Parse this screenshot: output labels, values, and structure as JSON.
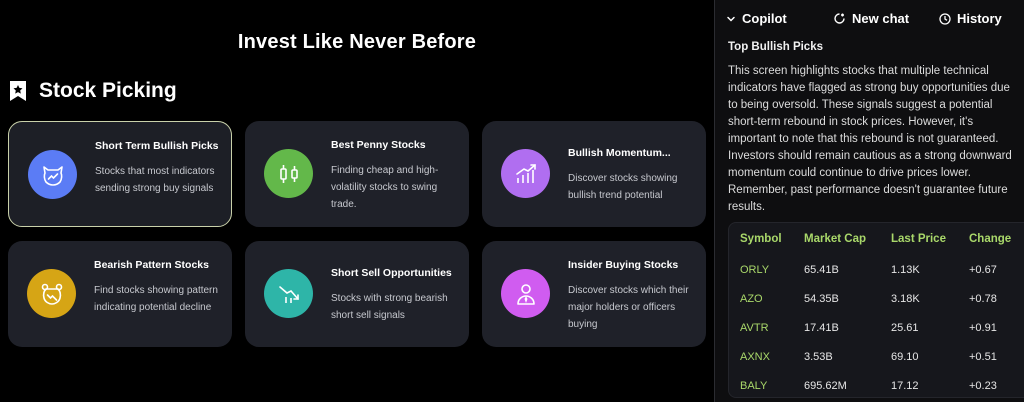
{
  "hero": {
    "title": "Invest Like Never Before"
  },
  "section": {
    "title": "Stock Picking",
    "icon": "bookmark-star-icon"
  },
  "cards": [
    {
      "title": "Short Term Bullish Picks",
      "desc": "Stocks that most indicators sending strong buy signals",
      "icon": "bull-chart-icon",
      "color": "#5b7cf5"
    },
    {
      "title": "Best Penny Stocks",
      "desc": "Finding cheap and high-volatility stocks to swing trade.",
      "icon": "candlestick-icon",
      "color": "#63b84a"
    },
    {
      "title": "Bullish Momentum...",
      "desc": "Discover stocks showing bullish trend potential",
      "icon": "bar-trend-up-icon",
      "color": "#b06ef0"
    },
    {
      "title": "Bearish Pattern Stocks",
      "desc": "Find stocks showing pattern indicating potential decline",
      "icon": "bear-chart-icon",
      "color": "#d6a515"
    },
    {
      "title": "Short Sell Opportunities",
      "desc": "Stocks with strong bearish short sell signals",
      "icon": "trend-down-icon",
      "color": "#2eb5a8"
    },
    {
      "title": "Insider Buying Stocks",
      "desc": "Discover stocks which their major holders or officers buying",
      "icon": "insider-person-icon",
      "color": "#d05cf0"
    }
  ],
  "copilot": {
    "title": "Copilot",
    "new_chat": "New chat",
    "history": "History",
    "answer_title": "Top Bullish Picks",
    "answer_body": "This screen highlights stocks that multiple technical indicators have flagged as strong buy opportunities due to being oversold. These signals suggest a potential short-term rebound in stock prices. However, it's important to note that this rebound is not guaranteed. Investors should remain cautious as a strong downward momentum could continue to drive prices lower. Remember, past performance doesn't guarantee future results."
  },
  "table": {
    "headers": [
      "Symbol",
      "Market Cap",
      "Last Price",
      "Change"
    ],
    "rows": [
      [
        "ORLY",
        "65.41B",
        "1.13K",
        "+0.67"
      ],
      [
        "AZO",
        "54.35B",
        "3.18K",
        "+0.78"
      ],
      [
        "AVTR",
        "17.41B",
        "25.61",
        "+0.91"
      ],
      [
        "AXNX",
        "3.53B",
        "69.10",
        "+0.51"
      ],
      [
        "BALY",
        "695.62M",
        "17.12",
        "+0.23"
      ]
    ]
  }
}
